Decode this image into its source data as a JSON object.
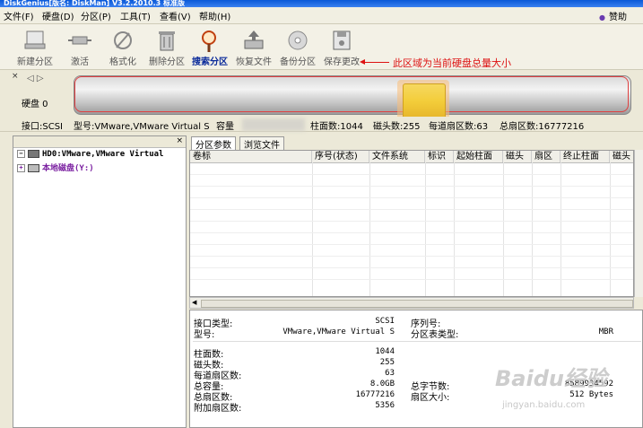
{
  "titlebar": {
    "title": "DiskGenius[版名: DiskMan] V3.2.2010.3 标准版"
  },
  "menu": {
    "items": [
      "文件(F)",
      "硬盘(D)",
      "分区(P)",
      "工具(T)",
      "查看(V)",
      "帮助(H)"
    ],
    "sponsor": "赞助"
  },
  "toolbar": {
    "buttons": [
      {
        "label": "新建分区",
        "icon": "new-partition-icon"
      },
      {
        "label": "激活",
        "icon": "activate-icon"
      },
      {
        "label": "格式化",
        "icon": "format-icon"
      },
      {
        "label": "删除分区",
        "icon": "delete-partition-icon"
      },
      {
        "label": "搜索分区",
        "icon": "search-partition-icon"
      },
      {
        "label": "恢复文件",
        "icon": "recover-files-icon"
      },
      {
        "label": "备份分区",
        "icon": "backup-partition-icon"
      },
      {
        "label": "保存更改",
        "icon": "save-changes-icon"
      }
    ]
  },
  "annotation": {
    "text": "此区域为当前硬盘总量大小",
    "color": "#dd1111"
  },
  "diskbar": {
    "label": "硬盘 0"
  },
  "disk_info": {
    "interface": "接口:SCSI",
    "model": "型号:VMware,VMware Virtual S",
    "capacity": "容量",
    "cylinders": "柱面数:1044",
    "heads": "磁头数:255",
    "sectors_per_track": "每道扇区数:63",
    "total_sectors": "总扇区数:16777216"
  },
  "tree": {
    "items": [
      {
        "label": "HD0:VMware,VMware Virtual",
        "color": "#000000"
      },
      {
        "label": "本地磁盘(Y:)",
        "color": "#7a1fa0"
      }
    ]
  },
  "tabs": [
    "分区参数",
    "浏览文件"
  ],
  "table": {
    "columns": [
      "卷标",
      "序号(状态)",
      "文件系统",
      "标识",
      "起始柱面",
      "磁头",
      "扇区",
      "终止柱面",
      "磁头"
    ]
  },
  "details": {
    "left": [
      {
        "label": "接口类型:",
        "value": "SCSI"
      },
      {
        "label": "型号:",
        "value": "VMware,VMware Virtual S"
      },
      {
        "label": "柱面数:",
        "value": "1044"
      },
      {
        "label": "磁头数:",
        "value": "255"
      },
      {
        "label": "每道扇区数:",
        "value": "63"
      },
      {
        "label": "总容量:",
        "value": "8.0GB"
      },
      {
        "label": "总扇区数:",
        "value": "16777216"
      },
      {
        "label": "附加扇区数:",
        "value": "5356"
      }
    ],
    "right": [
      {
        "label": "序列号:",
        "value": ""
      },
      {
        "label": "分区表类型:",
        "value": "MBR"
      },
      {
        "label": "总字节数:",
        "value": "8589934592"
      },
      {
        "label": "扇区大小:",
        "value": "512 Bytes"
      }
    ]
  },
  "watermark": {
    "brand": "Baidu经验",
    "url": "jingyan.baidu.com"
  }
}
